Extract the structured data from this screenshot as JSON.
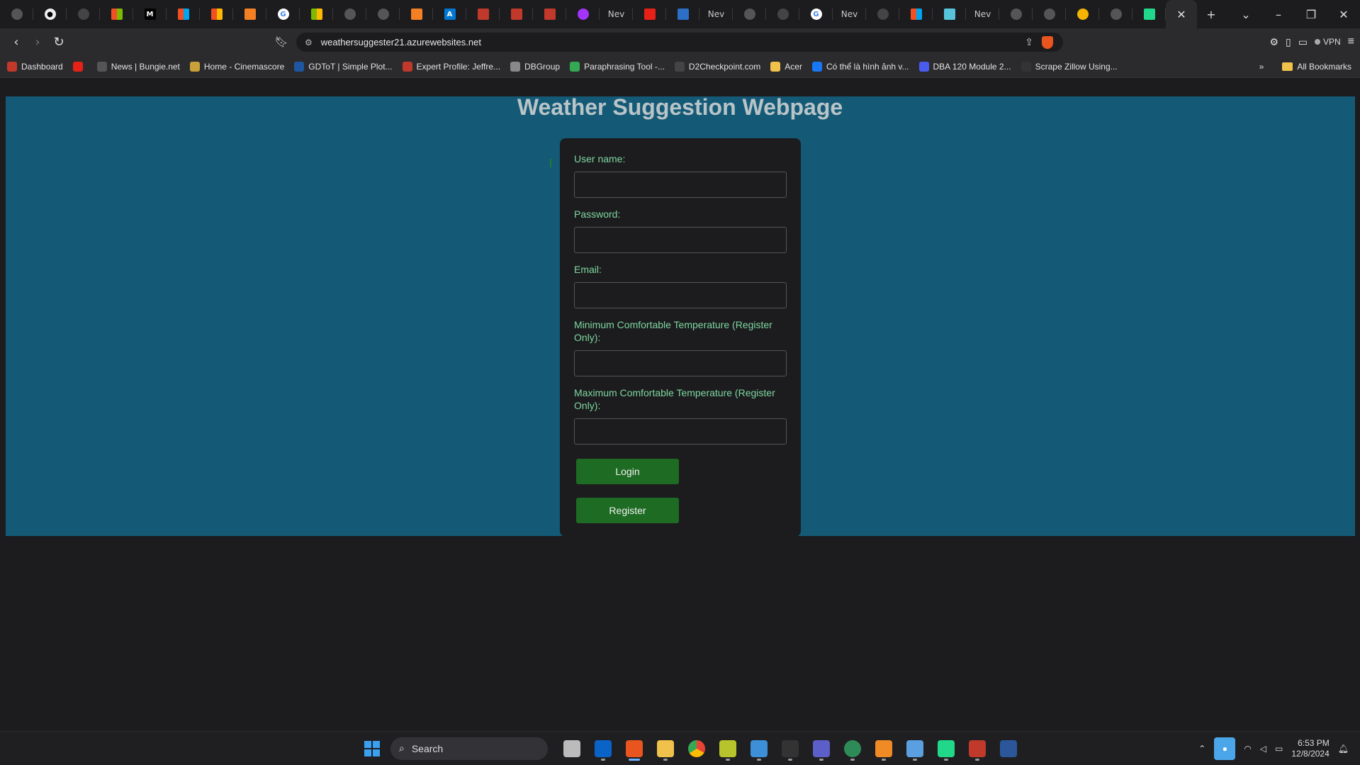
{
  "browser": {
    "url": "weathersuggester21.azurewebsites.net",
    "vpn_label": "VPN",
    "newtab_labels": [
      "Nev",
      "Nev",
      "Nev",
      "Nev"
    ],
    "bookmarks": [
      {
        "label": "Dashboard",
        "color": "#c0392b"
      },
      {
        "label": "",
        "color": "#e62117"
      },
      {
        "label": "News | Bungie.net",
        "color": "#555555"
      },
      {
        "label": "Home - Cinemascore",
        "color": "#c9a13b"
      },
      {
        "label": "GDToT | Simple Plot...",
        "color": "#1e56a0"
      },
      {
        "label": "Expert Profile: Jeffre...",
        "color": "#c0392b"
      },
      {
        "label": "DBGroup",
        "color": "#888888"
      },
      {
        "label": "Paraphrasing Tool -...",
        "color": "#35a853"
      },
      {
        "label": "D2Checkpoint.com",
        "color": "#444444"
      },
      {
        "label": "Acer",
        "color": "#f0c24b"
      },
      {
        "label": "Có thể là hình ảnh v...",
        "color": "#1877f2"
      },
      {
        "label": "DBA 120 Module 2...",
        "color": "#4a5cf0"
      },
      {
        "label": "Scrape Zillow Using...",
        "color": "#333333"
      }
    ],
    "all_bookmarks_label": "All Bookmarks"
  },
  "page": {
    "title": "Weather Suggestion Webpage",
    "form": {
      "username_label": "User name:",
      "password_label": "Password:",
      "email_label": "Email:",
      "min_temp_label": "Minimum Comfortable Temperature (Register Only):",
      "max_temp_label": "Maximum Comfortable Temperature (Register Only):",
      "login_button": "Login",
      "register_button": "Register"
    }
  },
  "taskbar": {
    "search_placeholder": "Search",
    "time": "6:53 PM",
    "date": "12/8/2024"
  },
  "colors": {
    "page_bg": "#145a76",
    "label_green": "#7ed6a0",
    "button_green": "#1e6b23"
  }
}
